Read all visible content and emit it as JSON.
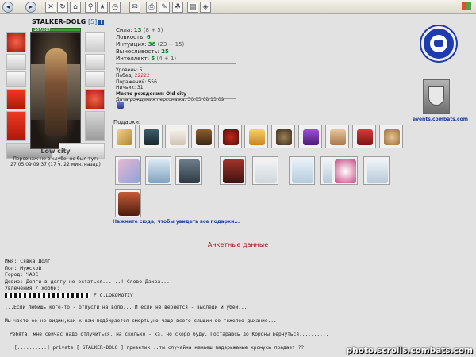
{
  "character": {
    "name": "STALKER-DOLG",
    "level": "[5]",
    "badge": "i",
    "hp": "267/267",
    "location": "Low city",
    "club_note_line1": "Персонаж не в клубе, но был тут:",
    "club_note_line2": "27.05.09 09:37 (17 ч. 22 мин. назад)"
  },
  "stats": {
    "strength": {
      "label": "Сила:",
      "value": "13",
      "bonus": "(8 + 5)"
    },
    "agility": {
      "label": "Ловкость:",
      "value": "6",
      "bonus": ""
    },
    "intuition": {
      "label": "Интуиция:",
      "value": "38",
      "bonus": "(23 + 15)"
    },
    "endurance": {
      "label": "Выносливость:",
      "value": "25",
      "bonus": ""
    },
    "intellect": {
      "label": "Интеллект:",
      "value": "5",
      "bonus": "(4 + 1)"
    }
  },
  "info": {
    "level": {
      "label": "Уровень:",
      "value": "5"
    },
    "wins": {
      "label": "Побед:",
      "value": "22222"
    },
    "losses": {
      "label": "Поражений:",
      "value": "556"
    },
    "draws": {
      "label": "Ничьих:",
      "value": "31"
    },
    "birthplace": {
      "label": "Место рождения:",
      "value": "Old city"
    },
    "birthdate": {
      "label": "Дата рождения персонажа:",
      "value": "30.03.08 13:09"
    }
  },
  "gifts": {
    "label": "Подарки:",
    "link": "Нажмите сюда, чтобы увидеть все подарки..."
  },
  "clan": {
    "site": "events.combats.com"
  },
  "section_title": "Анкетные данные",
  "profile": {
    "name_label": "Имя:",
    "name": "Сявка Долг",
    "sex_label": "Пол:",
    "sex": "Мужской",
    "city_label": "Город:",
    "city": "ЧАЭС",
    "motto_label": "Девиз:",
    "motto": "Долги в долгу не остаться......! Слово Дахра....",
    "hobby_label": "Увлечения / хобби:",
    "hobby_text": "F.C.LOKOMOTIV"
  },
  "lines": [
    "...Если любишь кого-то - отпусти на волю... И если не вернется - выследи и убей...",
    "Мы часто ее не видим,как к нам подбирается смерть,но чаще всего слышим ее тяжелое дыхание...",
    "Ребята, мне сейчас надо отлучиться, на сколько - хз, но скоро буду. Постараюсь до Короны вернуться..........",
    "[..........] private [ STALKER-DOLG ] приветик ..ты случайна немаеш падерьжаные кромусы прадает ??"
  ],
  "watermark": "photo.scrolls.combats.com"
}
